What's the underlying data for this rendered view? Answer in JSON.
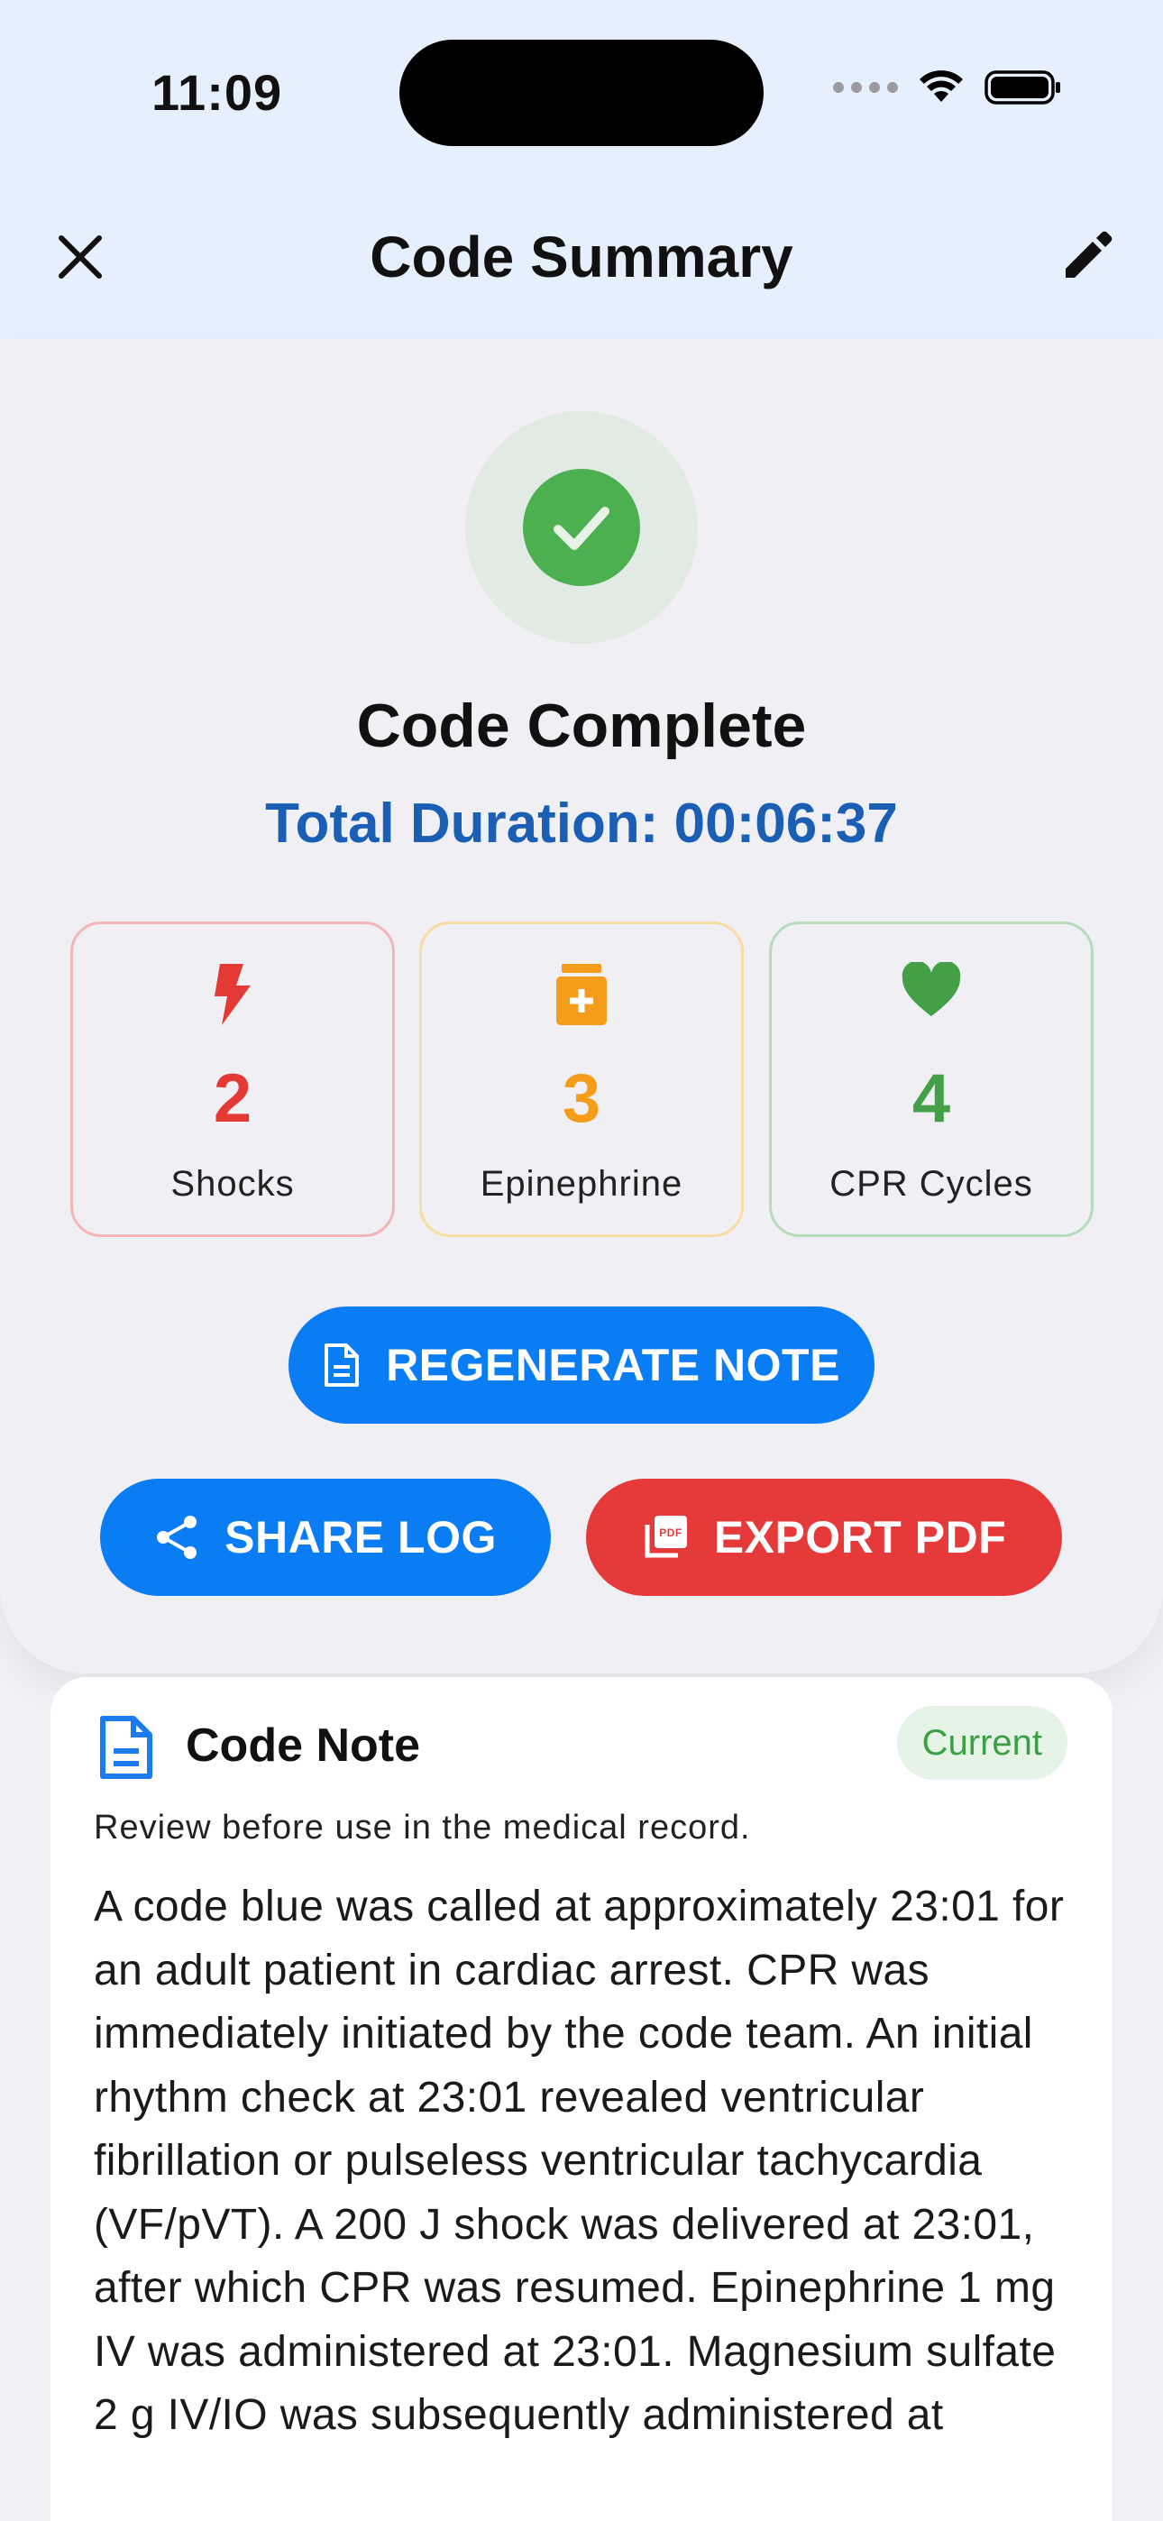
{
  "status_bar": {
    "time": "11:09"
  },
  "nav": {
    "title": "Code Summary",
    "close_icon": "close-icon",
    "edit_icon": "pencil-icon"
  },
  "summary": {
    "status_icon": "check-circle-icon",
    "title": "Code Complete",
    "duration": "Total Duration: 00:06:37",
    "stats": [
      {
        "icon": "bolt-icon",
        "value": "2",
        "label": "Shocks",
        "color": "#e53935"
      },
      {
        "icon": "medicine-bottle-icon",
        "value": "3",
        "label": "Epinephrine",
        "color": "#f59c1a"
      },
      {
        "icon": "heart-icon",
        "value": "4",
        "label": "CPR Cycles",
        "color": "#43a047"
      }
    ]
  },
  "actions": {
    "regenerate_label": "REGENERATE NOTE",
    "share_label": "SHARE LOG",
    "export_label": "EXPORT PDF"
  },
  "note": {
    "title": "Code Note",
    "badge": "Current",
    "subtitle": "Review before use in the medical record.",
    "body": "A code blue was called at approximately 23:01 for an adult patient in cardiac arrest. CPR was immediately initiated by the code team. An initial rhythm check at 23:01 revealed ventricular fibrillation or pulseless ventricular tachycardia (VF/pVT). A 200 J shock was delivered at 23:01, after which CPR was resumed. Epinephrine 1 mg IV was administered at 23:01. Magnesium sulfate 2 g IV/IO was subsequently administered at"
  },
  "colors": {
    "primary": "#0a7cf4",
    "danger": "#e63a3a",
    "success": "#4caf50",
    "duration_text": "#1a5fb4"
  }
}
